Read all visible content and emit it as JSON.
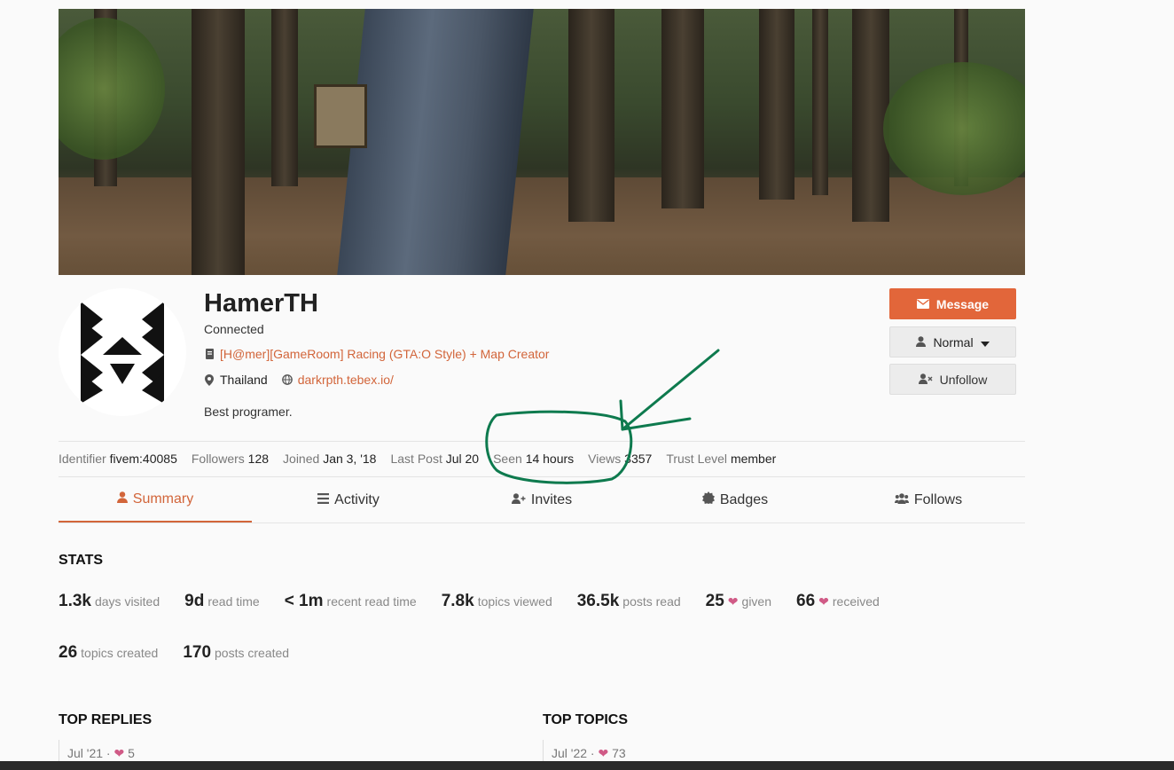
{
  "profile": {
    "username": "HamerTH",
    "title": "Connected",
    "server": "[H@mer][GameRoom] Racing (GTA:O Style) + Map Creator",
    "location": "Thailand",
    "website": "darkrpth.tebex.io/",
    "bio": "Best programer."
  },
  "actions": {
    "message": "Message",
    "notification_level": "Normal",
    "unfollow": "Unfollow"
  },
  "meta": [
    {
      "key": "Identifier",
      "value": "fivem:40085"
    },
    {
      "key": "Followers",
      "value": "128"
    },
    {
      "key": "Joined",
      "value": "Jan 3, '18"
    },
    {
      "key": "Last Post",
      "value": "Jul 20"
    },
    {
      "key": "Seen",
      "value": "14 hours"
    },
    {
      "key": "Views",
      "value": "3357"
    },
    {
      "key": "Trust Level",
      "value": "member"
    }
  ],
  "tabs": [
    "Summary",
    "Activity",
    "Invites",
    "Badges",
    "Follows"
  ],
  "stats": {
    "title": "STATS",
    "row1": [
      {
        "num": "1.3k",
        "label": "days visited"
      },
      {
        "num": "9d",
        "label": "read time"
      },
      {
        "num": "< 1m",
        "label": "recent read time"
      },
      {
        "num": "7.8k",
        "label": "topics viewed"
      },
      {
        "num": "36.5k",
        "label": "posts read"
      },
      {
        "num": "25",
        "label": "given"
      },
      {
        "num": "66",
        "label": "received"
      }
    ],
    "row2": [
      {
        "num": "26",
        "label": "topics created"
      },
      {
        "num": "170",
        "label": "posts created"
      }
    ]
  },
  "top_replies": {
    "title": "TOP REPLIES",
    "date": "Jul '21 ·",
    "likes": "5"
  },
  "top_topics": {
    "title": "TOP TOPICS",
    "date": "Jul '22 ·",
    "likes": "73"
  },
  "colors": {
    "accent": "#d2653a",
    "button": "#e2663a",
    "heart": "#d05a86",
    "annotation": "#0e7a4e"
  }
}
